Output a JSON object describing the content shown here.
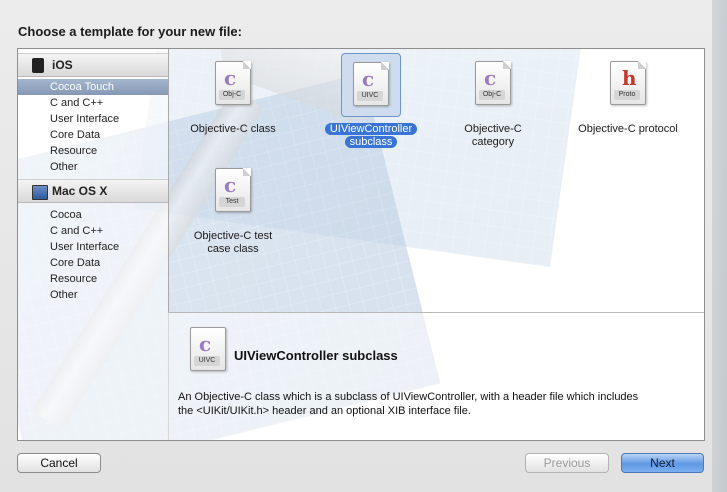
{
  "dialog": {
    "title": "Choose a template for your new file:"
  },
  "sidebar": {
    "groups": [
      {
        "name": "iOS",
        "icon": "iphone-icon",
        "items": [
          "Cocoa Touch",
          "C and C++",
          "User Interface",
          "Core Data",
          "Resource",
          "Other"
        ],
        "selected": "Cocoa Touch"
      },
      {
        "name": "Mac OS X",
        "icon": "mac-icon",
        "items": [
          "Cocoa",
          "C and C++",
          "User Interface",
          "Core Data",
          "Resource",
          "Other"
        ]
      }
    ]
  },
  "templates": [
    {
      "label": "Objective-C class",
      "tag": "Obj-C",
      "glyph": "c"
    },
    {
      "label": "UIViewController subclass",
      "label_line1": "UIViewController",
      "label_line2": "subclass",
      "tag": "UIVC",
      "glyph": "c",
      "selected": true
    },
    {
      "label_line1": "Objective-C",
      "label_line2": "category",
      "tag": "Obj-C",
      "glyph": "c"
    },
    {
      "label": "Objective-C protocol",
      "tag": "Proto",
      "glyph": "h"
    },
    {
      "label_line1": "Objective-C test",
      "label_line2": "case class",
      "tag": "Test",
      "glyph": "c"
    }
  ],
  "description": {
    "title": "UIViewController subclass",
    "tag": "UIVC",
    "line1": "An Objective-C class which is a subclass of UIViewController, with a header file which includes",
    "line2": "the <UIKit/UIKit.h> header and an optional XIB interface file."
  },
  "buttons": {
    "cancel": "Cancel",
    "previous": "Previous",
    "next": "Next"
  }
}
